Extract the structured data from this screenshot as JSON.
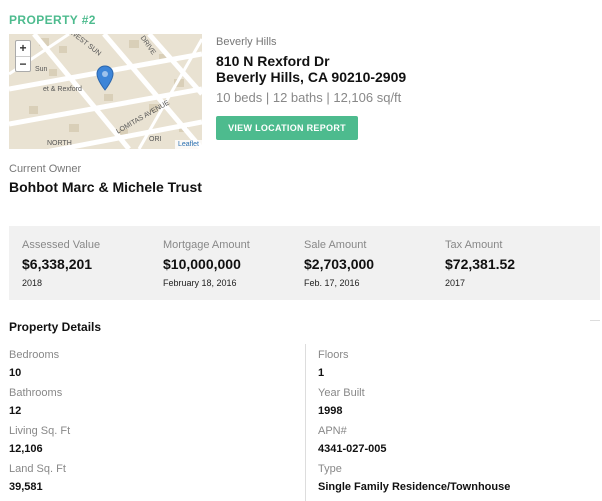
{
  "property_label": "PROPERTY #2",
  "map": {
    "zoom_in": "+",
    "zoom_out": "−",
    "streets": [
      "WEST SUN",
      "DRIVE",
      "Sun",
      "et & Rexford",
      "LOMITAS AVENUE",
      "NORTH",
      "ORI"
    ],
    "attribution": "Leaflet"
  },
  "address": {
    "city": "Beverly Hills",
    "line1": "810 N Rexford Dr",
    "line2": "Beverly Hills, CA 90210-2909",
    "summary": "10 beds | 12 baths | 12,106 sq/ft"
  },
  "report_button": "VIEW LOCATION REPORT",
  "owner": {
    "label": "Current Owner",
    "name": "Bohbot Marc & Michele Trust"
  },
  "stats": [
    {
      "label": "Assessed Value",
      "value": "$6,338,201",
      "sub": "2018"
    },
    {
      "label": "Mortgage Amount",
      "value": "$10,000,000",
      "sub": "February 18, 2016"
    },
    {
      "label": "Sale Amount",
      "value": "$2,703,000",
      "sub": "Feb. 17, 2016"
    },
    {
      "label": "Tax Amount",
      "value": "$72,381.52",
      "sub": "2017"
    }
  ],
  "details": {
    "title": "Property Details",
    "left": [
      {
        "label": "Bedrooms",
        "value": "10"
      },
      {
        "label": "Bathrooms",
        "value": "12"
      },
      {
        "label": "Living Sq. Ft",
        "value": "12,106"
      },
      {
        "label": "Land Sq. Ft",
        "value": "39,581"
      }
    ],
    "right": [
      {
        "label": "Floors",
        "value": "1"
      },
      {
        "label": "Year Built",
        "value": "1998"
      },
      {
        "label": "APN#",
        "value": "4341-027-005"
      },
      {
        "label": "Type",
        "value": "Single Family Residence/Townhouse"
      }
    ]
  },
  "colors": {
    "accent": "#4dbb8e",
    "stats_bg": "#f1f1f1",
    "map_bg": "#e9e2d2",
    "marker": "#3d85d8"
  }
}
